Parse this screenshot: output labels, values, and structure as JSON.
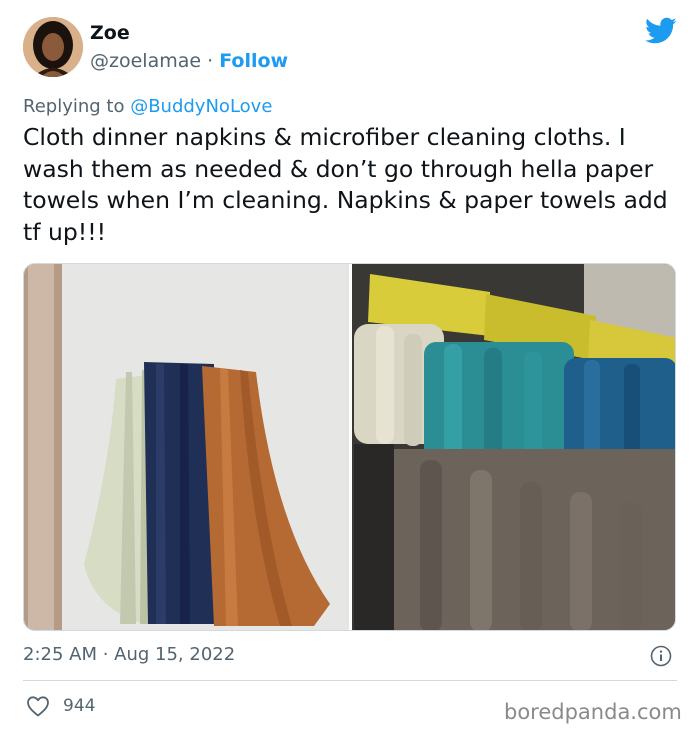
{
  "author": {
    "display_name": "Zoe",
    "handle": "@zoelamae",
    "separator": "·",
    "follow_label": "Follow"
  },
  "reply": {
    "prefix": "Replying to ",
    "mention": "@BuddyNoLove"
  },
  "tweet": {
    "text": "Cloth dinner napkins & microfiber cleaning cloths. I wash them as needed & don’t go through hella paper towels when I’m cleaning. Napkins & paper towels add tf up!!!",
    "timestamp": "2:25 AM · Aug 15, 2022"
  },
  "stats": {
    "likes": "944"
  },
  "watermark": "boredpanda.com",
  "colors": {
    "accent": "#1d9bf0",
    "text": "#0f1419",
    "secondary": "#536471",
    "border": "#cfd9de"
  },
  "icons": {
    "brand": "twitter-bird-icon",
    "info": "info-icon",
    "like": "heart-icon"
  }
}
